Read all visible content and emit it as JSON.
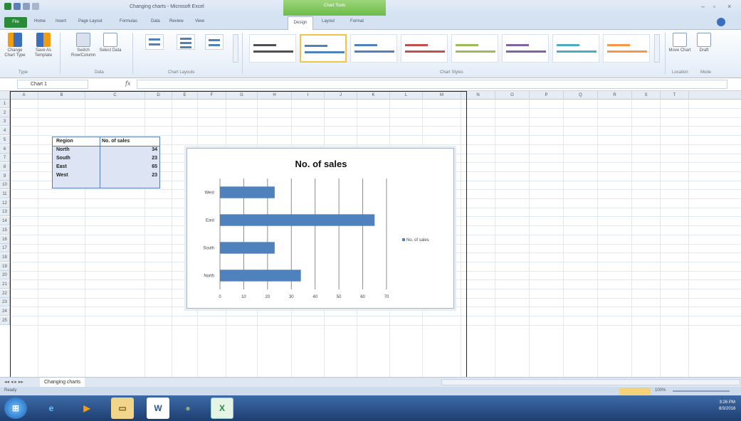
{
  "window": {
    "title": "Changing charts - Microsoft Excel",
    "context_tab_group": "Chart Tools"
  },
  "ribbon_tabs": [
    "File",
    "Home",
    "Insert",
    "Page Layout",
    "Formulas",
    "Data",
    "Review",
    "View",
    "Design",
    "Layout",
    "Format"
  ],
  "ribbon": {
    "change_chart_type": "Change Chart Type",
    "save_as_template": "Save As Template",
    "switch_row_column": "Switch Row/Column",
    "select_data": "Select Data",
    "group_type": "Type",
    "group_data": "Data",
    "group_chart_layouts": "Chart Layouts",
    "group_chart_styles": "Chart Styles",
    "move_chart": "Move Chart",
    "draft": "Draft",
    "group_location": "Location",
    "group_mode": "Mode",
    "style_colors": [
      "#4f4f4f",
      "#4f81bd",
      "#4f81bd",
      "#c0504d",
      "#9bbb59",
      "#8064a2",
      "#4bacc6",
      "#f79646"
    ]
  },
  "formula_bar": {
    "name_box": "Chart 1",
    "fx": "fx",
    "value": ""
  },
  "columns": [
    "A",
    "B",
    "C",
    "D",
    "E",
    "F",
    "G",
    "H",
    "I",
    "J",
    "K",
    "L",
    "M",
    "N",
    "O",
    "P",
    "Q",
    "R",
    "S",
    "T"
  ],
  "rows": [
    "1",
    "2",
    "3",
    "4",
    "5",
    "6",
    "7",
    "8",
    "9",
    "10",
    "11",
    "12",
    "13",
    "14",
    "15",
    "16",
    "17",
    "18",
    "19",
    "20",
    "21",
    "22",
    "23",
    "24",
    "25"
  ],
  "table": {
    "header_region": "Region",
    "header_sales": "No. of sales",
    "rows": [
      {
        "region": "North",
        "sales": "34"
      },
      {
        "region": "South",
        "sales": "23"
      },
      {
        "region": "East",
        "sales": "65"
      },
      {
        "region": "West",
        "sales": "23"
      }
    ]
  },
  "chart_data": {
    "type": "bar",
    "orientation": "horizontal",
    "title": "No. of sales",
    "categories": [
      "North",
      "South",
      "East",
      "West"
    ],
    "series": [
      {
        "name": "No. of sales",
        "values": [
          34,
          23,
          65,
          23
        ],
        "color": "#4f81bd"
      }
    ],
    "xlim": [
      0,
      70
    ],
    "x_ticks": [
      "0",
      "10",
      "20",
      "30",
      "40",
      "50",
      "60",
      "70"
    ],
    "grid": "vertical",
    "legend": "right"
  },
  "sheet_tab": "Changing charts",
  "status": {
    "ready": "Ready",
    "zoom": "100%"
  },
  "taskbar": {
    "clock_time": "3:26 PM",
    "clock_date": "8/3/2016"
  }
}
